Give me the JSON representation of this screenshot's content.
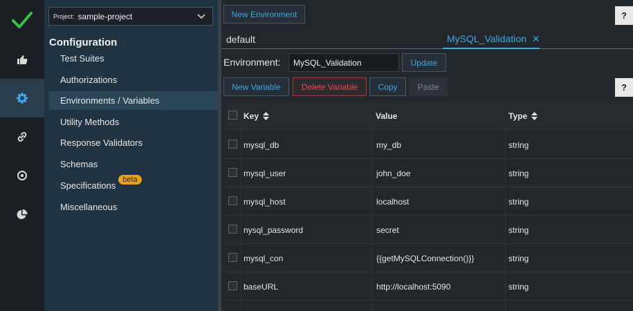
{
  "rail": {
    "items": [
      {
        "icon": "thumbs-up-icon"
      },
      {
        "icon": "gear-icon"
      },
      {
        "icon": "link-icon"
      },
      {
        "icon": "target-icon"
      },
      {
        "icon": "pie-chart-icon"
      }
    ]
  },
  "sidebar": {
    "project_label": "Project:",
    "project_value": "sample-project",
    "heading": "Configuration",
    "items": [
      {
        "label": "Test Suites"
      },
      {
        "label": "Authorizations"
      },
      {
        "label": "Environments / Variables"
      },
      {
        "label": "Utility Methods"
      },
      {
        "label": "Response Validators"
      },
      {
        "label": "Schemas"
      },
      {
        "label": "Specifications"
      },
      {
        "label": "Miscellaneous"
      }
    ],
    "badge": "beta"
  },
  "toolbar": {
    "new_env": "New Environment",
    "help": "?"
  },
  "tabs": {
    "default": "default",
    "active": "MySQL_Validation",
    "close": "✕"
  },
  "env": {
    "label": "Environment:",
    "value": "MySQL_Validation",
    "update": "Update"
  },
  "actions": {
    "new_variable": "New Variable",
    "delete_variable": "Delete Variable",
    "copy": "Copy",
    "paste": "Paste",
    "help": "?"
  },
  "table": {
    "columns": {
      "key": "Key",
      "value": "Value",
      "type": "Type"
    },
    "rows": [
      {
        "key": "mysql_db",
        "value": "my_db",
        "type": "string"
      },
      {
        "key": "mysql_user",
        "value": "john_doe",
        "type": "string"
      },
      {
        "key": "mysql_host",
        "value": "localhost",
        "type": "string"
      },
      {
        "key": "nysql_password",
        "value": "secret",
        "type": "string"
      },
      {
        "key": "mysql_con",
        "value": "{{getMySQLConnection()}}",
        "type": "string"
      },
      {
        "key": "baseURL",
        "value": "http://localhost:5090",
        "type": "string"
      }
    ]
  },
  "colors": {
    "accent": "#3fa6e0",
    "danger": "#e25050",
    "badge": "#e8a11a",
    "logo": "#3cbf4a"
  }
}
